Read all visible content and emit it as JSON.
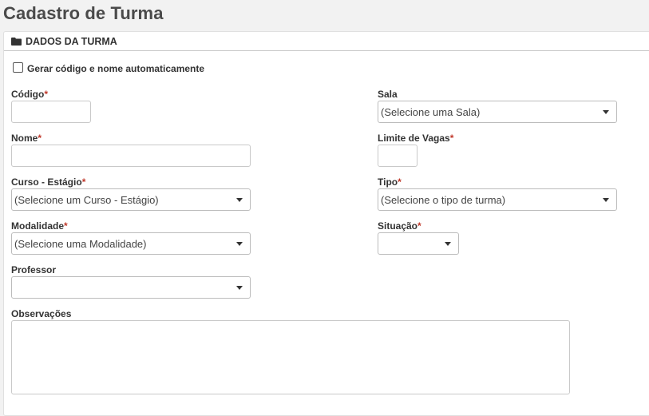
{
  "page": {
    "title": "Cadastro de Turma"
  },
  "panel": {
    "title": "DADOS DA TURMA",
    "icon": "folder-icon"
  },
  "auto_generate": {
    "label": "Gerar código e nome automaticamente",
    "checked": false
  },
  "fields": {
    "codigo": {
      "label": "Código",
      "required_mark": "*",
      "value": ""
    },
    "nome": {
      "label": "Nome",
      "required_mark": "*",
      "value": ""
    },
    "curso": {
      "label": "Curso - Estágio",
      "required_mark": "*",
      "selected": "(Selecione um Curso - Estágio)"
    },
    "modalidade": {
      "label": "Modalidade",
      "required_mark": "*",
      "selected": "(Selecione uma Modalidade)"
    },
    "professor": {
      "label": "Professor",
      "selected": ""
    },
    "observacoes": {
      "label": "Observações",
      "value": ""
    },
    "sala": {
      "label": "Sala",
      "selected": "(Selecione uma Sala)"
    },
    "limite_vagas": {
      "label": "Limite de Vagas",
      "required_mark": "*",
      "value": ""
    },
    "tipo": {
      "label": "Tipo",
      "required_mark": "*",
      "selected": "(Selecione o tipo de turma)"
    },
    "situacao": {
      "label": "Situação",
      "required_mark": "*",
      "selected": ""
    }
  },
  "colors": {
    "required": "#c0392b",
    "background": "#f2f2f2",
    "panel": "#ffffff"
  }
}
